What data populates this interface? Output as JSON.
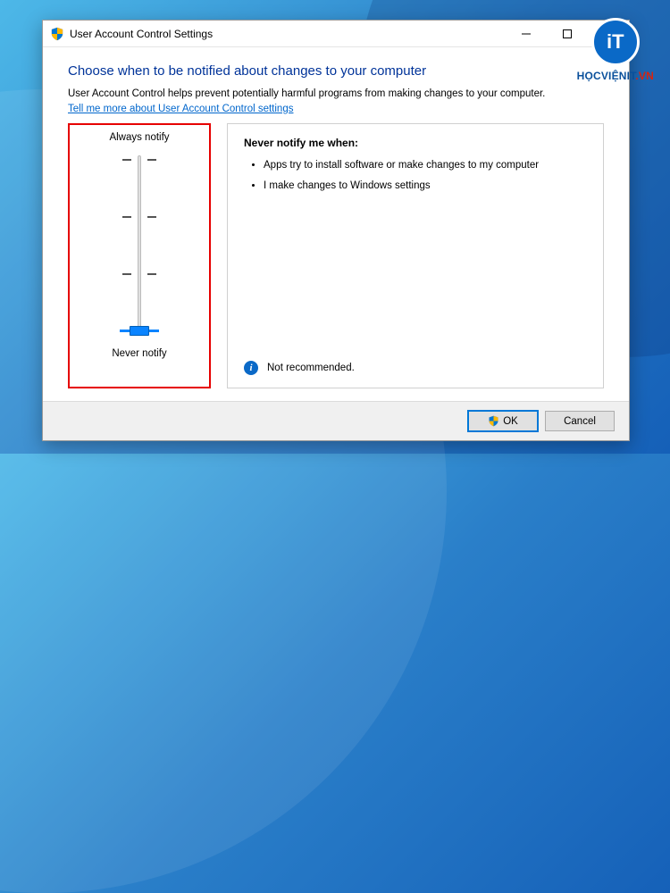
{
  "window": {
    "title": "User Account Control Settings"
  },
  "content": {
    "heading": "Choose when to be notified about changes to your computer",
    "description": "User Account Control helps prevent potentially harmful programs from making changes to your computer.",
    "link": "Tell me more about User Account Control settings"
  },
  "slider": {
    "top_label": "Always notify",
    "bottom_label": "Never notify",
    "levels": 4,
    "current_level": 0
  },
  "info": {
    "title": "Never notify me when:",
    "bullets": [
      "Apps try to install software or make changes to my computer",
      "I make changes to Windows settings"
    ],
    "recommendation": "Not recommended."
  },
  "buttons": {
    "ok": "OK",
    "cancel": "Cancel"
  },
  "watermark": {
    "badge": "iT",
    "text_prefix": "HỌCVIỆN",
    "text_mid": "IT",
    "text_suffix": ".VN"
  }
}
